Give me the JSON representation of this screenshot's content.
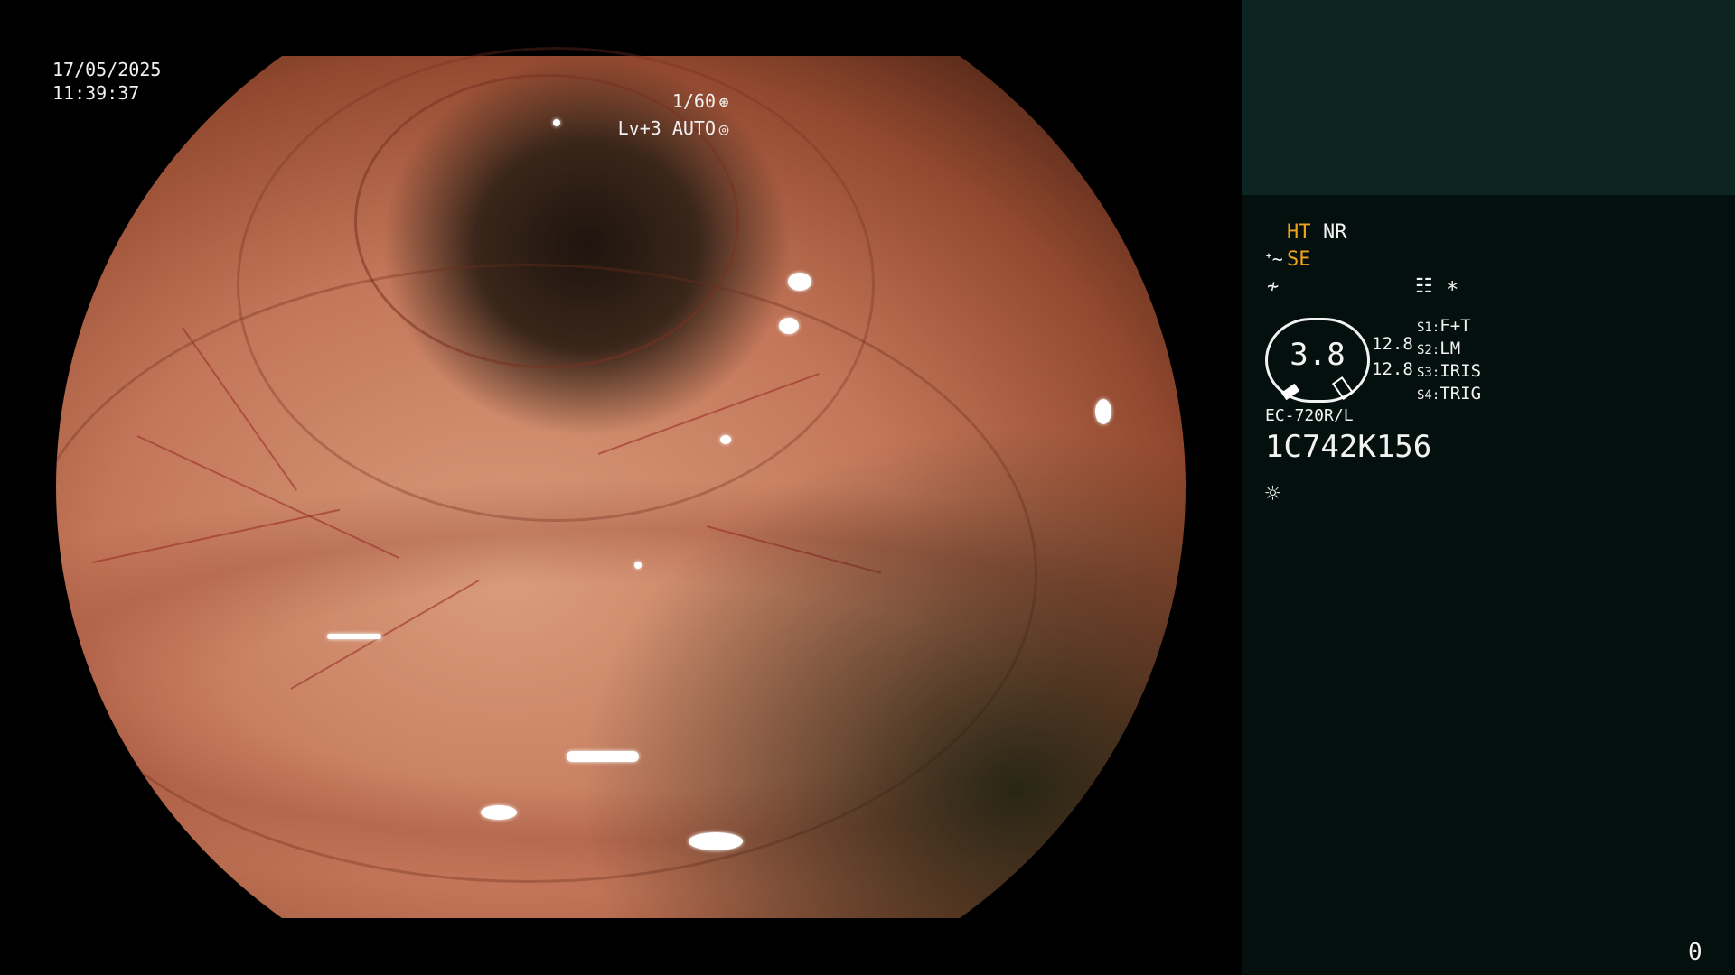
{
  "osd": {
    "date": "17/05/2025",
    "time": "11:39:37",
    "shutter": "1/60",
    "shutter_icon": "aperture-icon",
    "level": "Lv+3",
    "exposure": "AUTO",
    "exposure_icon": "auto-exposure-icon"
  },
  "panel": {
    "ht": "HT",
    "nr": "NR",
    "se": "SE",
    "enhance_icon": "enhancement-icon",
    "filter_icon": "filter-icon",
    "menu_icon": "settings-list-icon",
    "asterisk": "*",
    "gauge_value": "3.8",
    "gauge_left_12_8_top": "12.8",
    "gauge_left_12_8_bottom": "12.8",
    "switches": [
      {
        "key": "S1:",
        "value": "F+T"
      },
      {
        "key": "S2:",
        "value": "LM"
      },
      {
        "key": "S3:",
        "value": "IRIS"
      },
      {
        "key": "S4:",
        "value": "TRIG"
      }
    ],
    "scope_model": "EC-720R/L",
    "serial": "1C742K156",
    "lamp_icon": "lamp-sun-icon",
    "page_number": "0"
  },
  "colors": {
    "accent": "#f0a21c",
    "panel_bg": "#03100d",
    "panel_top_bg": "#0c2422",
    "text": "#f2f2f2"
  }
}
